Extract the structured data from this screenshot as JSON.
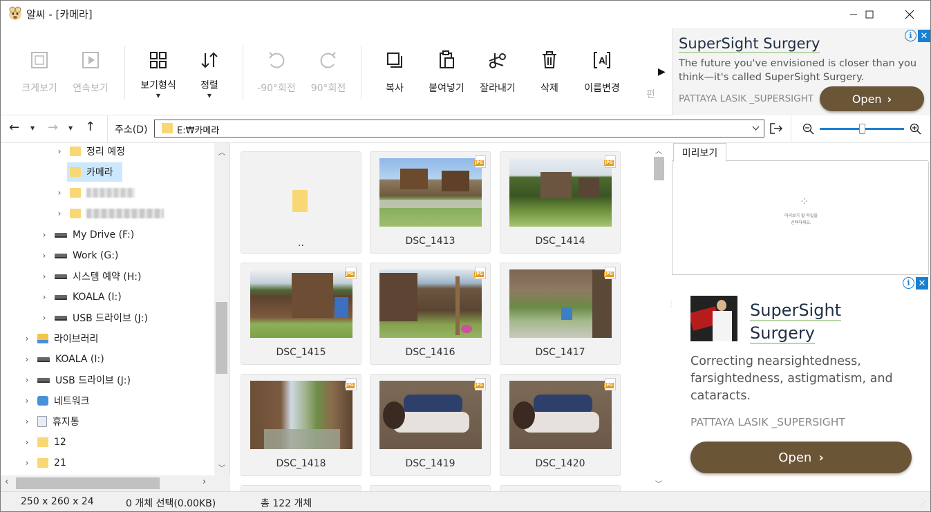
{
  "window": {
    "title": "알씨 - [카메라]"
  },
  "toolbar": {
    "fullview": "크게보기",
    "slideshow": "연속보기",
    "viewmode": "보기형식",
    "sort": "정렬",
    "rotate_left": "-90°회전",
    "rotate_right": "90°회전",
    "copy": "복사",
    "paste": "붙여넣기",
    "cut": "잘라내기",
    "delete": "삭제",
    "rename": "이름변경",
    "more": "편"
  },
  "ad_top": {
    "title": "SuperSight Surgery",
    "body": "The future you've envisioned is closer than you think—it's called SuperSight Surgery.",
    "source": "PATTAYA LASIK _SUPERSIGHT",
    "button": "Open"
  },
  "address": {
    "label": "주소(D)",
    "path": "E:₩카메라"
  },
  "tree": {
    "items": [
      {
        "label": "정리 예정",
        "type": "folder"
      },
      {
        "label": "카메라",
        "type": "folder",
        "selected": true
      },
      {
        "label": "",
        "type": "folder",
        "blurred": true
      },
      {
        "label": "",
        "type": "folder",
        "blurred": true
      },
      {
        "label": "My Drive (F:)",
        "type": "drive"
      },
      {
        "label": "Work (G:)",
        "type": "drive"
      },
      {
        "label": "시스템 예약 (H:)",
        "type": "drive"
      },
      {
        "label": "KOALA (I:)",
        "type": "drive"
      },
      {
        "label": "USB 드라이브 (J:)",
        "type": "drive"
      },
      {
        "label": "라이브러리",
        "type": "library"
      },
      {
        "label": "KOALA (I:)",
        "type": "drive"
      },
      {
        "label": "USB 드라이브 (J:)",
        "type": "drive"
      },
      {
        "label": "네트워크",
        "type": "network"
      },
      {
        "label": "휴지통",
        "type": "recycle"
      },
      {
        "label": "12",
        "type": "folder"
      },
      {
        "label": "21",
        "type": "folder"
      }
    ]
  },
  "grid": {
    "items": [
      {
        "label": ".."
      },
      {
        "label": "DSC_1413"
      },
      {
        "label": "DSC_1414"
      },
      {
        "label": "DSC_1415"
      },
      {
        "label": "DSC_1416"
      },
      {
        "label": "DSC_1417"
      },
      {
        "label": "DSC_1418"
      },
      {
        "label": "DSC_1419"
      },
      {
        "label": "DSC_1420"
      }
    ],
    "badge": "JPG"
  },
  "preview": {
    "tab": "미리보기",
    "hint_line1": "미리보기 할 파일을",
    "hint_line2": "선택하세요."
  },
  "ad_side": {
    "title": "SuperSight Surgery",
    "body": "Correcting nearsightedness, farsightedness, astigmatism, and cataracts.",
    "source": "PATTAYA LASIK _SUPERSIGHT",
    "button": "Open"
  },
  "status": {
    "size": "250 x 260 x 24",
    "selection": "0 개체 선택(0.00KB)",
    "total": "총 122 개체"
  },
  "colors": {
    "ad_button": "#6b5537",
    "ad_title": "#1f2f45",
    "selection": "#cce8ff",
    "accent": "#1b7fd1"
  }
}
